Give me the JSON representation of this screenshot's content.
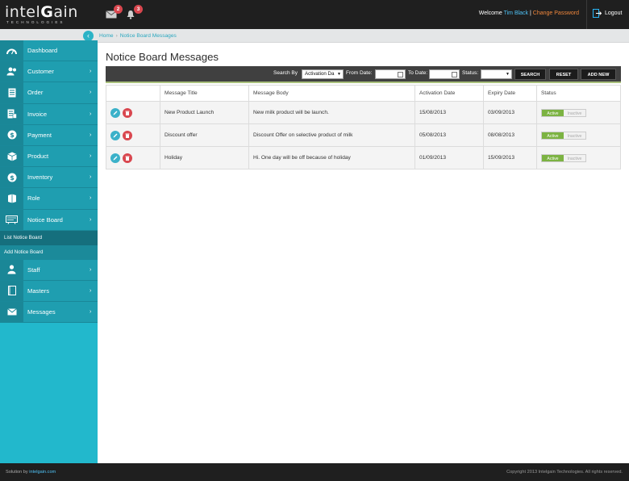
{
  "header": {
    "logo_text_a": "intel",
    "logo_text_g": "G",
    "logo_text_b": "ain",
    "logo_sub": "TECHNOLOGIES",
    "mail_count": "2",
    "alert_count": "3",
    "welcome_label": "Welcome",
    "user_name": "Tim Black",
    "separator": "|",
    "change_password": "Change Password",
    "logout": "Logout"
  },
  "sidebar": {
    "items": [
      {
        "label": "Dashboard",
        "icon": "dashboard-icon"
      },
      {
        "label": "Customer",
        "icon": "customer-icon"
      },
      {
        "label": "Order",
        "icon": "order-icon"
      },
      {
        "label": "Invoice",
        "icon": "invoice-icon"
      },
      {
        "label": "Payment",
        "icon": "payment-icon"
      },
      {
        "label": "Product",
        "icon": "product-icon"
      },
      {
        "label": "Inventory",
        "icon": "inventory-icon"
      },
      {
        "label": "Role",
        "icon": "role-icon"
      },
      {
        "label": "Notice Board",
        "icon": "notice-board-icon"
      },
      {
        "label": "Staff",
        "icon": "staff-icon"
      },
      {
        "label": "Masters",
        "icon": "masters-icon"
      },
      {
        "label": "Messages",
        "icon": "messages-icon"
      }
    ],
    "sub_items": [
      {
        "label": "List Notice Board"
      },
      {
        "label": "Add Notice Board"
      }
    ]
  },
  "breadcrumb": {
    "home": "Home",
    "current": "Notice Board Messages"
  },
  "page": {
    "title": "Notice Board Messages"
  },
  "filters": {
    "search_by_label": "Search By",
    "search_by_value": "Activation Da",
    "from_date_label": "From Date:",
    "from_date_value": "",
    "to_date_label": "To Date:",
    "to_date_value": "",
    "status_label": "Status:",
    "status_value": "",
    "search_button": "SEARCH",
    "reset_button": "RESET",
    "add_new_button": "ADD NEW"
  },
  "table": {
    "columns": [
      "",
      "Message Title",
      "Message Body",
      "Activation Date",
      "Expiry Date",
      "Status"
    ],
    "rows": [
      {
        "title": "New Product Launch",
        "body": "New milk product will be launch.",
        "activation": "15/08/2013",
        "expiry": "03/09/2013",
        "status_on": "Active",
        "status_off": "Inactive"
      },
      {
        "title": "Discount offer",
        "body": "Discount Offer on selective product of milk",
        "activation": "05/08/2013",
        "expiry": "08/08/2013",
        "status_on": "Active",
        "status_off": "Inactive"
      },
      {
        "title": "Holiday",
        "body": "Hi. One day will be off because of holiday",
        "activation": "01/09/2013",
        "expiry": "15/09/2013",
        "status_on": "Active",
        "status_off": "Inactive"
      }
    ]
  },
  "footer": {
    "solution_by": "Solution by",
    "solution_link": "intelgain.com",
    "copyright": "Copyright 2013 Intelgain Technologies. All rights reserved."
  },
  "colors": {
    "accent": "#22b8cc",
    "header_bg": "#1f1f1f",
    "delete": "#d9474f",
    "active": "#7cb342",
    "change_password": "#f0873c"
  }
}
